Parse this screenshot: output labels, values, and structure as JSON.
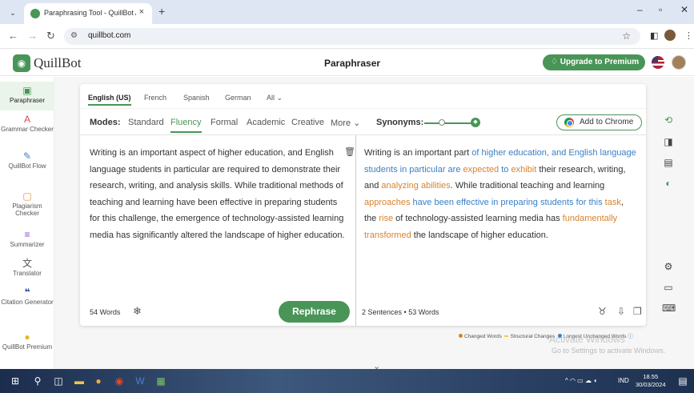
{
  "browser": {
    "tab_title": "Paraphrasing Tool - QuillBot AI",
    "tab_close": "×",
    "new_tab": "+",
    "url": "quillbot.com",
    "window_controls": [
      "–",
      "▫",
      "✕"
    ]
  },
  "header": {
    "brand": "QuillBot",
    "page_title": "Paraphraser",
    "premium_label": "Upgrade to Premium"
  },
  "sidebar": {
    "items": [
      {
        "label": "Paraphraser",
        "icon": "paraphraser-icon"
      },
      {
        "label": "Grammar Checker",
        "icon": "grammar-icon"
      },
      {
        "label": "QuillBot Flow",
        "icon": "flow-icon"
      },
      {
        "label": "Plagiarism Checker",
        "icon": "plagiarism-icon"
      },
      {
        "label": "Summarizer",
        "icon": "summarizer-icon"
      },
      {
        "label": "Translator",
        "icon": "translator-icon"
      },
      {
        "label": "Citation Generator",
        "icon": "citation-icon"
      },
      {
        "label": "QuillBot Premium",
        "icon": "premium-icon"
      }
    ]
  },
  "languages": [
    "English (US)",
    "French",
    "Spanish",
    "German",
    "All ⌄"
  ],
  "modes": {
    "label": "Modes:",
    "items": [
      "Standard",
      "Fluency",
      "Formal",
      "Academic",
      "Creative",
      "More ⌄"
    ],
    "active": "Fluency"
  },
  "synonyms": {
    "label": "Synonyms:",
    "level_fraction": 1.0
  },
  "chrome_ext": {
    "label": "Add to Chrome"
  },
  "input": {
    "text": "Writing is an important aspect of higher education, and English language students in particular are required to demonstrate their research, writing, and analysis skills. While traditional methods of teaching and learning have been effective in preparing students for this challenge, the emergence of technology-assisted learning media has significantly altered the landscape of higher education.",
    "word_count": "54 Words"
  },
  "rephrase_label": "Rephrase",
  "output": {
    "segments": [
      {
        "t": "Writing is an important part ",
        "c": ""
      },
      {
        "t": "of higher education, and English language students in particular are ",
        "c": "str"
      },
      {
        "t": "expected",
        "c": "chg"
      },
      {
        "t": " to ",
        "c": "str"
      },
      {
        "t": "exhibit",
        "c": "chg"
      },
      {
        "t": " their research, writing, and ",
        "c": ""
      },
      {
        "t": "analyzing abilities",
        "c": "chg"
      },
      {
        "t": ". While traditional teaching and learning ",
        "c": ""
      },
      {
        "t": "approaches",
        "c": "chg"
      },
      {
        "t": " have been effective in preparing students for this ",
        "c": "str"
      },
      {
        "t": "task",
        "c": "chg"
      },
      {
        "t": ", the ",
        "c": ""
      },
      {
        "t": "rise",
        "c": "chg"
      },
      {
        "t": " of technology-assisted learning media has ",
        "c": ""
      },
      {
        "t": "fundamentally transformed",
        "c": "chg"
      },
      {
        "t": " the landscape of higher education.",
        "c": ""
      }
    ],
    "stats": "2 Sentences • 53 Words"
  },
  "legend": {
    "changed": "Changed Words",
    "structural": "Structural Changes",
    "longest": "Longest Unchanged Words",
    "colors": {
      "changed": "#d9822b",
      "structural": "#f2c94c",
      "longest": "#3a7fc6"
    }
  },
  "watermark": {
    "title": "Activate Windows",
    "subtitle": "Go to Settings to activate Windows."
  },
  "taskbar": {
    "lang": "IND",
    "time": "18.55",
    "date": "30/03/2024"
  },
  "colors": {
    "accent": "#499557",
    "changed": "#d9822b",
    "structural_text": "#3a7fc6"
  }
}
